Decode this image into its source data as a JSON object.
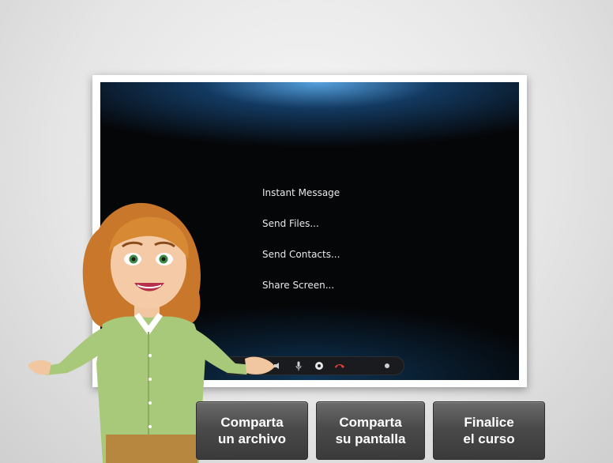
{
  "screen": {
    "menu_items": [
      {
        "label": "Instant Message"
      },
      {
        "label": "Send Files..."
      },
      {
        "label": "Send Contacts..."
      },
      {
        "label": "Share Screen..."
      }
    ],
    "call_controls": [
      "mute-icon",
      "microphone-icon",
      "video-icon",
      "end-call-icon",
      "more-icon"
    ]
  },
  "buttons": {
    "share_file": {
      "line1": "Comparta",
      "line2": "un archivo"
    },
    "share_screen": {
      "line1": "Comparta",
      "line2": "su pantalla"
    },
    "finish_course": {
      "line1": "Finalice",
      "line2": "el curso"
    }
  },
  "colors": {
    "button_bg": "#4a4a4a",
    "screen_glow": "#5aaaeb",
    "end_call": "#e0413a"
  }
}
